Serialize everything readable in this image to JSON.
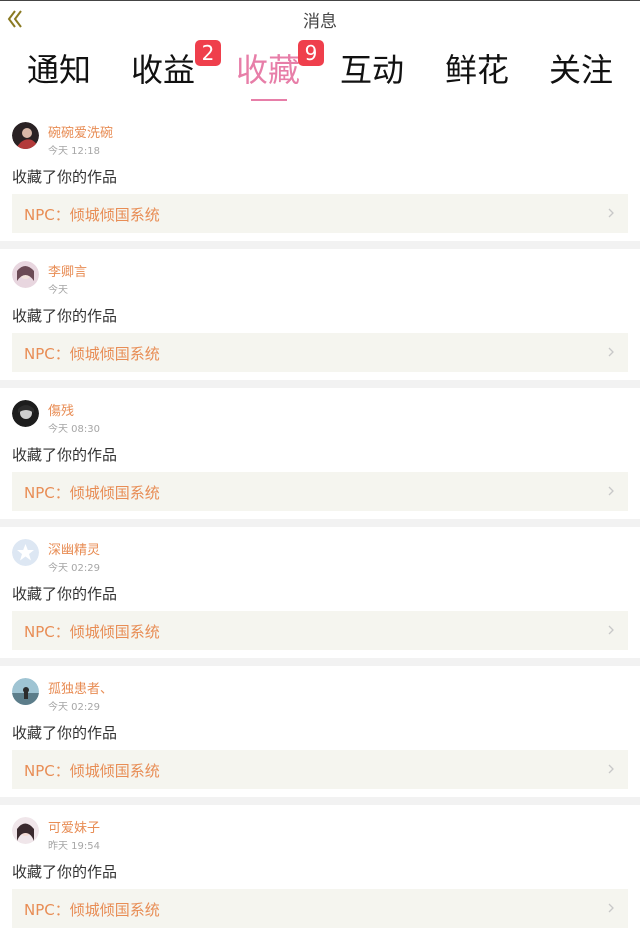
{
  "header": {
    "title": "消息",
    "back_icon": "chevron-double-left-icon"
  },
  "tabs": [
    {
      "label": "通知",
      "badge": ""
    },
    {
      "label": "收益",
      "badge": "2"
    },
    {
      "label": "收藏",
      "badge": "9",
      "active": true
    },
    {
      "label": "互动",
      "badge": ""
    },
    {
      "label": "鲜花",
      "badge": ""
    },
    {
      "label": "关注",
      "badge": ""
    }
  ],
  "colors": {
    "accent_pink": "#e77ea8",
    "name_orange": "#e88d55",
    "badge_red": "#ef3f4c",
    "work_bg": "#f5f5ef"
  },
  "notifications": [
    {
      "user": "碗碗爱洗碗",
      "time": "今天 12:18",
      "action": "收藏了你的作品",
      "work": "NPC：倾城倾国系统"
    },
    {
      "user": "李卿言",
      "time": "今天",
      "action": "收藏了你的作品",
      "work": "NPC：倾城倾国系统"
    },
    {
      "user": "傷残",
      "time": "今天 08:30",
      "action": "收藏了你的作品",
      "work": "NPC：倾城倾国系统"
    },
    {
      "user": "深幽精灵",
      "time": "今天 02:29",
      "action": "收藏了你的作品",
      "work": "NPC：倾城倾国系统"
    },
    {
      "user": "孤独患者、",
      "time": "今天 02:29",
      "action": "收藏了你的作品",
      "work": "NPC：倾城倾国系统"
    },
    {
      "user": "可爱妹子",
      "time": "昨天 19:54",
      "action": "收藏了你的作品",
      "work": "NPC：倾城倾国系统"
    }
  ]
}
